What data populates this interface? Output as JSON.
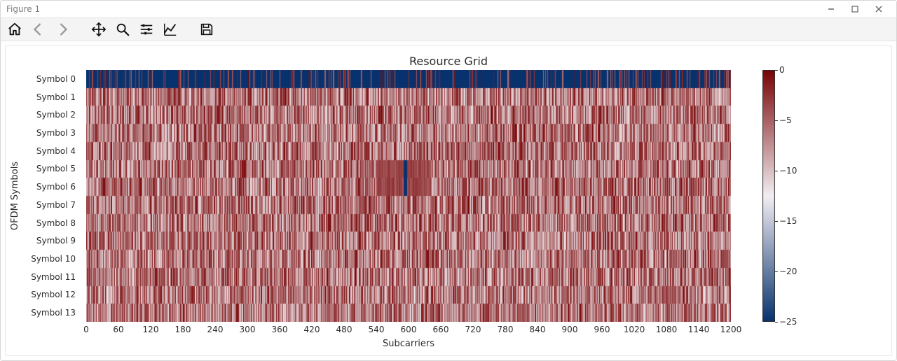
{
  "window": {
    "title": "Figure 1"
  },
  "toolbar": {
    "buttons": [
      {
        "name": "home-icon",
        "semantic": "home"
      },
      {
        "name": "back-icon",
        "semantic": "back"
      },
      {
        "name": "forward-icon",
        "semantic": "forward"
      },
      {
        "name": "move-icon",
        "semantic": "pan"
      },
      {
        "name": "zoom-icon",
        "semantic": "zoom"
      },
      {
        "name": "subplots-icon",
        "semantic": "configure-subplots"
      },
      {
        "name": "axes-icon",
        "semantic": "edit-axes"
      },
      {
        "name": "save-icon",
        "semantic": "save"
      }
    ]
  },
  "chart_data": {
    "type": "heatmap",
    "title": "Resource Grid",
    "xlabel": "Subcarriers",
    "ylabel": "OFDM Symbols",
    "xlim": [
      0,
      1200
    ],
    "ylim_labels": [
      "Symbol 0",
      "Symbol 1",
      "Symbol 2",
      "Symbol 3",
      "Symbol 4",
      "Symbol 5",
      "Symbol 6",
      "Symbol 7",
      "Symbol 8",
      "Symbol 9",
      "Symbol 10",
      "Symbol 11",
      "Symbol 12",
      "Symbol 13"
    ],
    "xticks": [
      0,
      60,
      120,
      180,
      240,
      300,
      360,
      420,
      480,
      540,
      600,
      660,
      720,
      780,
      840,
      900,
      960,
      1020,
      1080,
      1140,
      1200
    ],
    "colorbar": {
      "vmin": -25,
      "vmax": 0,
      "ticks": [
        0,
        -5,
        -10,
        -15,
        -20,
        -25
      ]
    },
    "nx": 1200,
    "ny": 14,
    "note": "Rows are OFDM symbols 0-13, columns are subcarrier indices 0..1199. Values are roughly random between -12 and 0 (mostly red shades). Symbol 0 (top row) contains many deep-blue values near -25 interleaved with red. A dark-red/blue patch spans subcarriers ~540-640 on Symbol 5 and Symbol 6."
  }
}
